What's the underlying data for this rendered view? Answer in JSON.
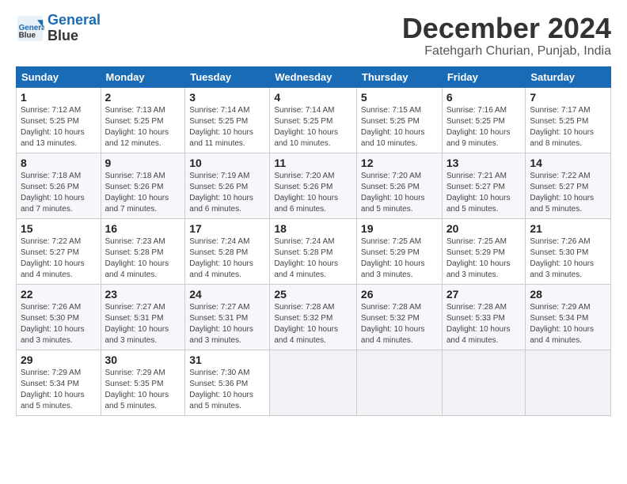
{
  "logo": {
    "line1": "General",
    "line2": "Blue"
  },
  "title": "December 2024",
  "location": "Fatehgarh Churian, Punjab, India",
  "days_of_week": [
    "Sunday",
    "Monday",
    "Tuesday",
    "Wednesday",
    "Thursday",
    "Friday",
    "Saturday"
  ],
  "weeks": [
    [
      {
        "day": 1,
        "info": "Sunrise: 7:12 AM\nSunset: 5:25 PM\nDaylight: 10 hours\nand 13 minutes."
      },
      {
        "day": 2,
        "info": "Sunrise: 7:13 AM\nSunset: 5:25 PM\nDaylight: 10 hours\nand 12 minutes."
      },
      {
        "day": 3,
        "info": "Sunrise: 7:14 AM\nSunset: 5:25 PM\nDaylight: 10 hours\nand 11 minutes."
      },
      {
        "day": 4,
        "info": "Sunrise: 7:14 AM\nSunset: 5:25 PM\nDaylight: 10 hours\nand 10 minutes."
      },
      {
        "day": 5,
        "info": "Sunrise: 7:15 AM\nSunset: 5:25 PM\nDaylight: 10 hours\nand 10 minutes."
      },
      {
        "day": 6,
        "info": "Sunrise: 7:16 AM\nSunset: 5:25 PM\nDaylight: 10 hours\nand 9 minutes."
      },
      {
        "day": 7,
        "info": "Sunrise: 7:17 AM\nSunset: 5:25 PM\nDaylight: 10 hours\nand 8 minutes."
      }
    ],
    [
      {
        "day": 8,
        "info": "Sunrise: 7:18 AM\nSunset: 5:26 PM\nDaylight: 10 hours\nand 7 minutes."
      },
      {
        "day": 9,
        "info": "Sunrise: 7:18 AM\nSunset: 5:26 PM\nDaylight: 10 hours\nand 7 minutes."
      },
      {
        "day": 10,
        "info": "Sunrise: 7:19 AM\nSunset: 5:26 PM\nDaylight: 10 hours\nand 6 minutes."
      },
      {
        "day": 11,
        "info": "Sunrise: 7:20 AM\nSunset: 5:26 PM\nDaylight: 10 hours\nand 6 minutes."
      },
      {
        "day": 12,
        "info": "Sunrise: 7:20 AM\nSunset: 5:26 PM\nDaylight: 10 hours\nand 5 minutes."
      },
      {
        "day": 13,
        "info": "Sunrise: 7:21 AM\nSunset: 5:27 PM\nDaylight: 10 hours\nand 5 minutes."
      },
      {
        "day": 14,
        "info": "Sunrise: 7:22 AM\nSunset: 5:27 PM\nDaylight: 10 hours\nand 5 minutes."
      }
    ],
    [
      {
        "day": 15,
        "info": "Sunrise: 7:22 AM\nSunset: 5:27 PM\nDaylight: 10 hours\nand 4 minutes."
      },
      {
        "day": 16,
        "info": "Sunrise: 7:23 AM\nSunset: 5:28 PM\nDaylight: 10 hours\nand 4 minutes."
      },
      {
        "day": 17,
        "info": "Sunrise: 7:24 AM\nSunset: 5:28 PM\nDaylight: 10 hours\nand 4 minutes."
      },
      {
        "day": 18,
        "info": "Sunrise: 7:24 AM\nSunset: 5:28 PM\nDaylight: 10 hours\nand 4 minutes."
      },
      {
        "day": 19,
        "info": "Sunrise: 7:25 AM\nSunset: 5:29 PM\nDaylight: 10 hours\nand 3 minutes."
      },
      {
        "day": 20,
        "info": "Sunrise: 7:25 AM\nSunset: 5:29 PM\nDaylight: 10 hours\nand 3 minutes."
      },
      {
        "day": 21,
        "info": "Sunrise: 7:26 AM\nSunset: 5:30 PM\nDaylight: 10 hours\nand 3 minutes."
      }
    ],
    [
      {
        "day": 22,
        "info": "Sunrise: 7:26 AM\nSunset: 5:30 PM\nDaylight: 10 hours\nand 3 minutes."
      },
      {
        "day": 23,
        "info": "Sunrise: 7:27 AM\nSunset: 5:31 PM\nDaylight: 10 hours\nand 3 minutes."
      },
      {
        "day": 24,
        "info": "Sunrise: 7:27 AM\nSunset: 5:31 PM\nDaylight: 10 hours\nand 3 minutes."
      },
      {
        "day": 25,
        "info": "Sunrise: 7:28 AM\nSunset: 5:32 PM\nDaylight: 10 hours\nand 4 minutes."
      },
      {
        "day": 26,
        "info": "Sunrise: 7:28 AM\nSunset: 5:32 PM\nDaylight: 10 hours\nand 4 minutes."
      },
      {
        "day": 27,
        "info": "Sunrise: 7:28 AM\nSunset: 5:33 PM\nDaylight: 10 hours\nand 4 minutes."
      },
      {
        "day": 28,
        "info": "Sunrise: 7:29 AM\nSunset: 5:34 PM\nDaylight: 10 hours\nand 4 minutes."
      }
    ],
    [
      {
        "day": 29,
        "info": "Sunrise: 7:29 AM\nSunset: 5:34 PM\nDaylight: 10 hours\nand 5 minutes."
      },
      {
        "day": 30,
        "info": "Sunrise: 7:29 AM\nSunset: 5:35 PM\nDaylight: 10 hours\nand 5 minutes."
      },
      {
        "day": 31,
        "info": "Sunrise: 7:30 AM\nSunset: 5:36 PM\nDaylight: 10 hours\nand 5 minutes."
      },
      null,
      null,
      null,
      null
    ]
  ]
}
